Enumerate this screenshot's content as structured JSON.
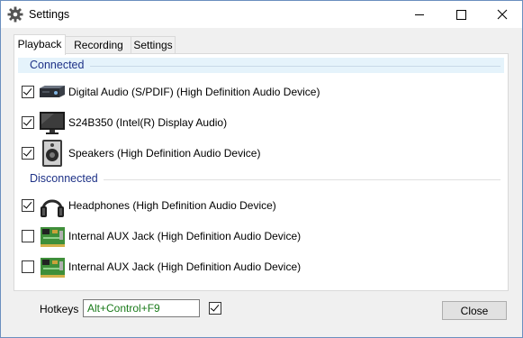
{
  "window": {
    "title": "Settings",
    "icon": "gear-icon"
  },
  "titlebar": {
    "minimize_icon": "minimize-icon",
    "maximize_icon": "maximize-icon",
    "close_icon": "close-icon"
  },
  "tabs": [
    {
      "label": "Playback",
      "active": true
    },
    {
      "label": "Recording",
      "active": false
    },
    {
      "label": "Settings",
      "active": false
    }
  ],
  "groups": {
    "connected": {
      "label": "Connected"
    },
    "disconnected": {
      "label": "Disconnected"
    }
  },
  "devices": [
    {
      "label": "Digital Audio (S/PDIF) (High Definition Audio Device)",
      "checked": true,
      "icon": "digital-audio-icon",
      "group": "connected"
    },
    {
      "label": "S24B350 (Intel(R) Display Audio)",
      "checked": true,
      "icon": "monitor-icon",
      "group": "connected"
    },
    {
      "label": "Speakers (High Definition Audio Device)",
      "checked": true,
      "icon": "speaker-icon",
      "group": "connected"
    },
    {
      "label": "Headphones (High Definition Audio Device)",
      "checked": true,
      "icon": "headphones-icon",
      "group": "disconnected"
    },
    {
      "label": "Internal AUX Jack (High Definition Audio Device)",
      "checked": false,
      "icon": "circuit-board-icon",
      "group": "disconnected"
    },
    {
      "label": "Internal AUX Jack (High Definition Audio Device)",
      "checked": false,
      "icon": "circuit-board-icon",
      "group": "disconnected"
    }
  ],
  "footer": {
    "hotkeys_label": "Hotkeys",
    "hotkeys_value": "Alt+Control+F9",
    "hotkeys_enabled": true,
    "close_label": "Close"
  },
  "colors": {
    "group_header_text": "#1e3287",
    "hotkey_text": "#1a7a1a",
    "connected_bg": "#e5f3fb"
  }
}
